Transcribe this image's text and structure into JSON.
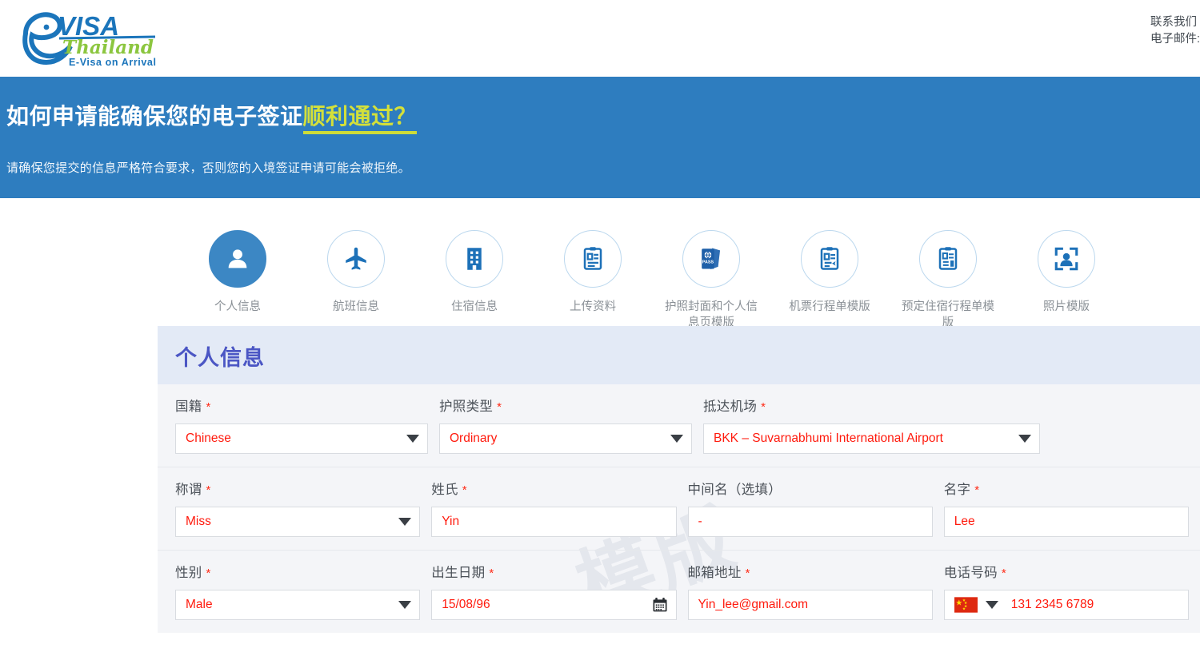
{
  "header": {
    "logo": {
      "brand_main": "VISA",
      "brand_script": "Thailand",
      "brand_tagline": "E-Visa on Arrival",
      "brand_e": "e"
    },
    "contact": {
      "line1": "联系我们",
      "line2": "电子邮件:"
    }
  },
  "banner": {
    "title_plain": "如何申请能确保您的电子签证",
    "title_highlight": "顺利通过？",
    "subtitle": "请确保您提交的信息严格符合要求，否则您的入境签证申请可能会被拒绝。",
    "bg_color": "#2e7dbf",
    "highlight_color": "#cddc39"
  },
  "steps": [
    {
      "label": "个人信息",
      "icon": "person-icon",
      "active": true
    },
    {
      "label": "航班信息",
      "icon": "airplane-icon",
      "active": false
    },
    {
      "label": "住宿信息",
      "icon": "building-icon",
      "active": false
    },
    {
      "label": "上传资料",
      "icon": "document-upload-icon",
      "active": false
    },
    {
      "label": "护照封面和个人信息页模版",
      "icon": "passport-icon",
      "active": false
    },
    {
      "label": "机票行程单模版",
      "icon": "ticket-itinerary-icon",
      "active": false
    },
    {
      "label": "预定住宿行程单模版",
      "icon": "hotel-booking-icon",
      "active": false
    },
    {
      "label": "照片模版",
      "icon": "photo-template-icon",
      "active": false
    }
  ],
  "form": {
    "section_title": "个人信息",
    "watermark": "模版",
    "rows": [
      {
        "fields": [
          {
            "label": "国籍",
            "required": true,
            "value": "Chinese",
            "control": "select"
          },
          {
            "label": "护照类型",
            "required": true,
            "value": "Ordinary",
            "control": "select"
          },
          {
            "label": "抵达机场",
            "required": true,
            "value": "BKK – Suvarnabhumi International Airport",
            "control": "select"
          }
        ]
      },
      {
        "fields": [
          {
            "label": "称谓",
            "required": true,
            "value": "Miss",
            "control": "select"
          },
          {
            "label": "姓氏",
            "required": true,
            "value": "Yin",
            "control": "text"
          },
          {
            "label": "中间名（选填）",
            "required": false,
            "value": "-",
            "control": "text"
          },
          {
            "label": "名字",
            "required": true,
            "value": "Lee",
            "control": "text"
          }
        ]
      },
      {
        "fields": [
          {
            "label": "性别",
            "required": true,
            "value": "Male",
            "control": "select"
          },
          {
            "label": "出生日期",
            "required": true,
            "value": "15/08/96",
            "control": "date"
          },
          {
            "label": "邮箱地址",
            "required": true,
            "value": "Yin_lee@gmail.com",
            "control": "text"
          },
          {
            "label": "电话号码",
            "required": true,
            "value": "131 2345 6789",
            "control": "phone",
            "flag": "china-flag-icon"
          }
        ]
      }
    ]
  },
  "colors": {
    "banner_blue": "#2e7dbf",
    "accent_blue": "#3c87c4",
    "value_red": "#ff1a0d",
    "title_purple": "#4b56c4",
    "lime": "#cddc39"
  }
}
